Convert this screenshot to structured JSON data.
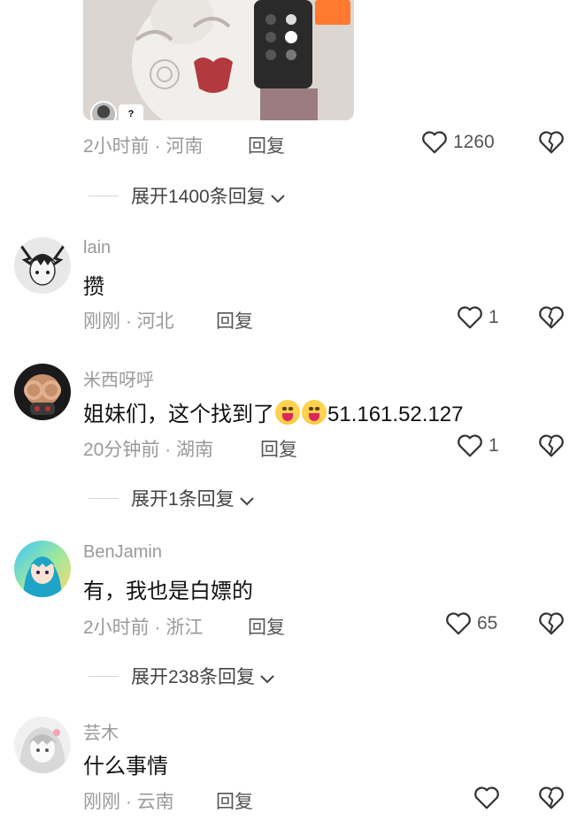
{
  "top_comment": {
    "time": "2小时前",
    "region": "河南",
    "reply_label": "回复",
    "likes": "1260",
    "expand_label": "展开1400条回复",
    "image_badge": "?"
  },
  "comments": [
    {
      "username": "lain",
      "text": "攒",
      "time": "刚刚",
      "region": "河北",
      "reply_label": "回复",
      "likes": "1"
    },
    {
      "username": "米西呀呼",
      "text_before": "姐妹们，这个找到了",
      "text_after": "51.161.52.127",
      "time": "20分钟前",
      "region": "湖南",
      "reply_label": "回复",
      "likes": "1",
      "expand_label": "展开1条回复"
    },
    {
      "username": "BenJamin",
      "text": "有，我也是白嫖的",
      "time": "2小时前",
      "region": "浙江",
      "reply_label": "回复",
      "likes": "65",
      "expand_label": "展开238条回复"
    },
    {
      "username": "芸木",
      "text": "什么事情",
      "time": "刚刚",
      "region": "云南",
      "reply_label": "回复",
      "likes": ""
    }
  ],
  "separator": " · ",
  "icons": {
    "like": "heart-outline-icon",
    "dislike": "broken-heart-icon",
    "expand": "chevron-down-icon",
    "emoji": "tongue-out-face-emoji"
  },
  "colors": {
    "meta": "#9a9a9a",
    "text": "#111111",
    "icon": "#333333"
  }
}
